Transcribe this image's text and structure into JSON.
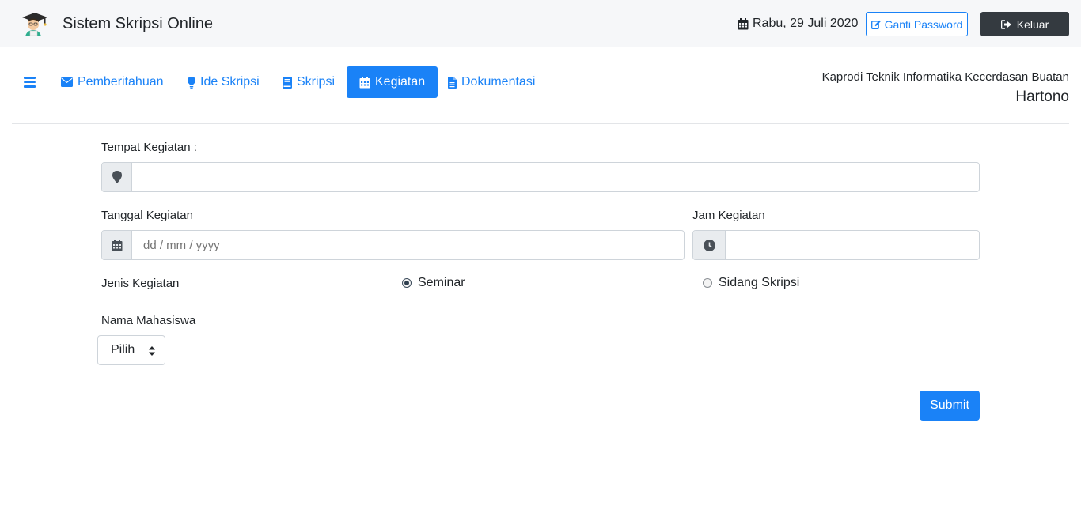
{
  "header": {
    "app_title": "Sistem Skripsi Online",
    "logo_icon": "graduate-student-icon",
    "date": "Rabu, 29 Juli 2020",
    "change_password_label": "Ganti Password",
    "logout_label": "Keluar"
  },
  "nav": {
    "items": [
      {
        "label": "Pemberitahuan",
        "icon": "envelope-icon"
      },
      {
        "label": "Ide Skripsi",
        "icon": "lightbulb-icon"
      },
      {
        "label": "Skripsi",
        "icon": "book-icon"
      },
      {
        "label": "Kegiatan",
        "icon": "calendar-icon",
        "active": true
      },
      {
        "label": "Dokumentasi",
        "icon": "file-icon"
      }
    ]
  },
  "user": {
    "role": "Kaprodi Teknik Informatika Kecerdasan Buatan",
    "name": "Hartono"
  },
  "form": {
    "tempat_label": "Tempat Kegiatan :",
    "tempat_value": "",
    "tanggal_label": "Tanggal Kegiatan",
    "tanggal_placeholder": "dd / mm / yyyy",
    "jam_label": "Jam Kegiatan",
    "jam_value": "",
    "jenis_label": "Jenis Kegiatan",
    "jenis_options": [
      {
        "label": "Seminar",
        "checked": true
      },
      {
        "label": "Sidang Skripsi",
        "checked": false
      }
    ],
    "mahasiswa_label": "Nama Mahasiswa",
    "mahasiswa_selected": "Pilih",
    "submit_label": "Submit"
  },
  "colors": {
    "primary": "#1a82f7",
    "dark": "#343a40",
    "topbar_bg": "#f6f7f9"
  }
}
